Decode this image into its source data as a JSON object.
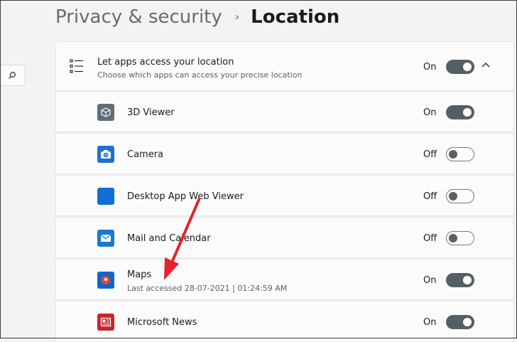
{
  "breadcrumb": {
    "parent": "Privacy & security",
    "separator": "›",
    "current": "Location"
  },
  "header": {
    "title": "Let apps access your location",
    "subtitle": "Choose which apps can access your precise location",
    "state": "On"
  },
  "apps": [
    {
      "name": "3D Viewer",
      "sub": "",
      "state": "On",
      "on": true,
      "icon": "cube-icon",
      "color": "#5f6f7a"
    },
    {
      "name": "Camera",
      "sub": "",
      "state": "Off",
      "on": false,
      "icon": "camera-icon",
      "color": "#1f6fd1"
    },
    {
      "name": "Desktop App Web Viewer",
      "sub": "",
      "state": "Off",
      "on": false,
      "icon": "web-viewer-icon",
      "color": "#0f6fd6"
    },
    {
      "name": "Mail and Calendar",
      "sub": "",
      "state": "Off",
      "on": false,
      "icon": "mail-icon",
      "color": "#1b78d0"
    },
    {
      "name": "Maps",
      "sub": "Last accessed 28-07-2021  |  01:24:59 AM",
      "state": "On",
      "on": true,
      "icon": "maps-icon",
      "color": "#1464c8"
    },
    {
      "name": "Microsoft News",
      "sub": "",
      "state": "On",
      "on": true,
      "icon": "news-icon",
      "color": "#c9242d"
    }
  ],
  "colors": {
    "toggle_on": "#545e65",
    "accent_blue": "#0f6fd6",
    "annotation_red": "#e3232a"
  }
}
